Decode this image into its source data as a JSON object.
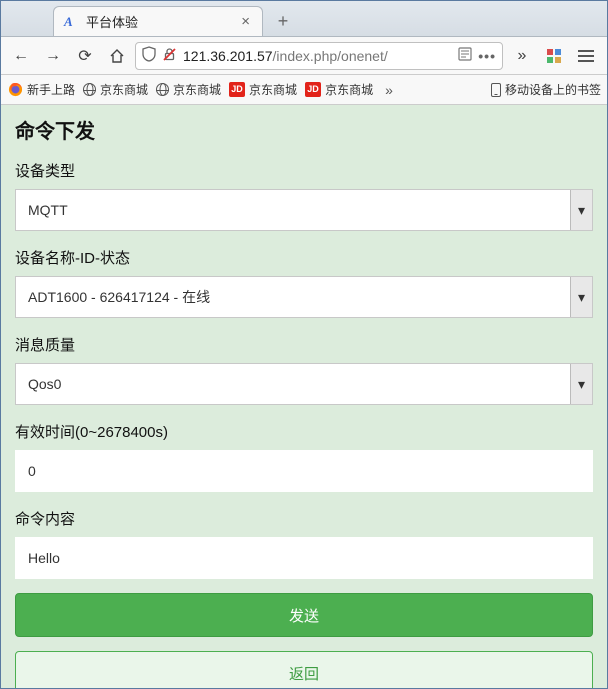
{
  "window": {
    "controls": {
      "min": "—",
      "max": "▢",
      "close": "✕"
    }
  },
  "tab": {
    "title": "平台体验",
    "close": "×",
    "newtab": "+"
  },
  "nav": {
    "back": "←",
    "forward": "→",
    "reload": "⟳",
    "home": "⌂",
    "overflow": "»"
  },
  "url": {
    "host": "121.36.201.57",
    "path": "/index.php/onenet/",
    "dots": "•••"
  },
  "bookmarks": {
    "items": [
      {
        "icon": "ff",
        "label": "新手上路"
      },
      {
        "icon": "globe",
        "label": "京东商城"
      },
      {
        "icon": "globe",
        "label": "京东商城"
      },
      {
        "icon": "jd",
        "label": "京东商城"
      },
      {
        "icon": "jd",
        "label": "京东商城"
      }
    ],
    "overflow": "»",
    "mobile_label": "移动设备上的书签"
  },
  "page": {
    "title": "命令下发",
    "device_type_label": "设备类型",
    "device_type_value": "MQTT",
    "device_name_label": "设备名称-ID-状态",
    "device_name_value": "ADT1600 - 626417124 - 在线",
    "qos_label": "消息质量",
    "qos_value": "Qos0",
    "ttl_label": "有效时间(0~2678400s)",
    "ttl_value": "0",
    "cmd_label": "命令内容",
    "cmd_value": "Hello",
    "send_btn": "发送",
    "back_btn": "返回"
  }
}
